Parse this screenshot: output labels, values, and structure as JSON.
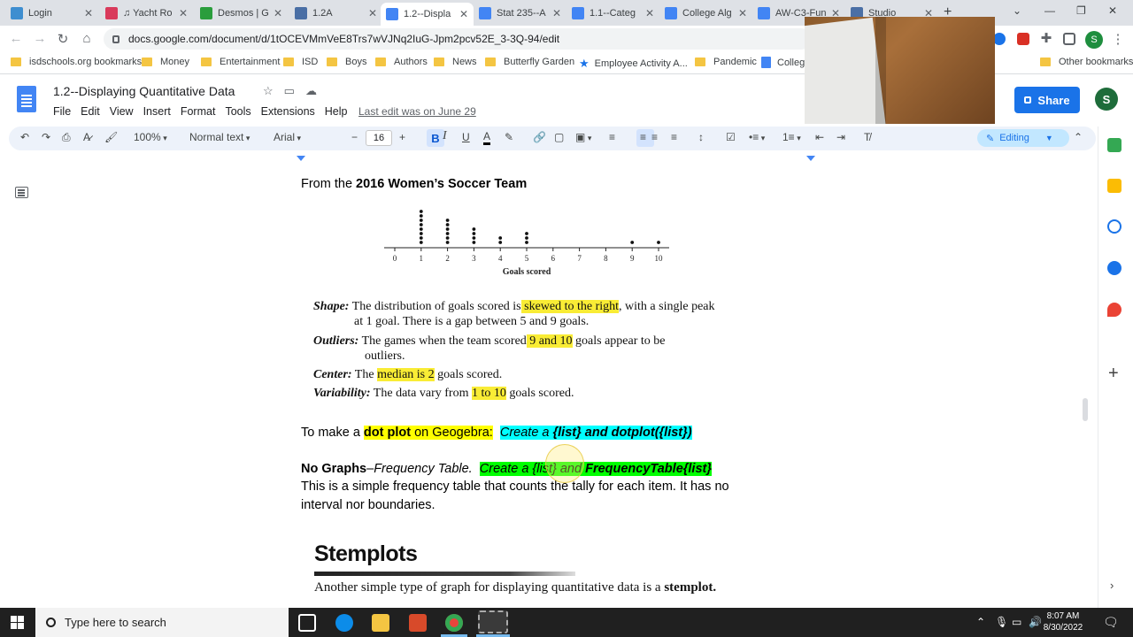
{
  "browser": {
    "tabs": [
      {
        "label": "Login",
        "color": "#3e8ed0"
      },
      {
        "label": "♫ Yacht Ro",
        "color": "#d93a5b"
      },
      {
        "label": "Desmos | G",
        "color": "#2a9d3c"
      },
      {
        "label": "1.2A",
        "color": "#4a6fa5"
      },
      {
        "label": "1.2--Displa",
        "color": "#4285f4"
      },
      {
        "label": "Stat 235--A",
        "color": "#4285f4"
      },
      {
        "label": "1.1--Categ",
        "color": "#4285f4"
      },
      {
        "label": "College Alg",
        "color": "#4285f4"
      },
      {
        "label": "AW-C3-Fun",
        "color": "#4285f4"
      },
      {
        "label": "Studio",
        "color": "#4a6fa5"
      }
    ],
    "url": "docs.google.com/document/d/1tOCEVMmVeE8Trs7wVJNq2IuG-Jpm2pcv52E_3-3Q-94/edit",
    "profile_initial": "S"
  },
  "bookmarks": [
    {
      "label": "isdschools.org bookmarks",
      "type": "folder"
    },
    {
      "label": "Money",
      "type": "folder"
    },
    {
      "label": "Entertainment",
      "type": "folder"
    },
    {
      "label": "ISD",
      "type": "folder"
    },
    {
      "label": "Boys",
      "type": "folder"
    },
    {
      "label": "Authors",
      "type": "folder"
    },
    {
      "label": "News",
      "type": "folder"
    },
    {
      "label": "Butterfly Garden",
      "type": "folder"
    },
    {
      "label": "Employee Activity A...",
      "type": "star"
    },
    {
      "label": "Pandemic",
      "type": "folder"
    },
    {
      "label": "College",
      "type": "doc"
    },
    {
      "label": "Other bookmarks",
      "type": "folder"
    }
  ],
  "docs": {
    "title": "1.2--Displaying Quantitative Data",
    "menu": [
      "File",
      "Edit",
      "View",
      "Insert",
      "Format",
      "Tools",
      "Extensions",
      "Help"
    ],
    "last_edit": "Last edit was on June 29",
    "share_label": "Share",
    "user_initial": "S"
  },
  "toolbar": {
    "zoom": "100%",
    "style": "Normal text",
    "font": "Arial",
    "size": "16",
    "mode": "Editing"
  },
  "content": {
    "intro_pre": "From the ",
    "intro_bold": "2016 Women’s Soccer Team",
    "dotplot": {
      "axis_label": "Goals scored",
      "ticks": [
        "0",
        "1",
        "2",
        "3",
        "4",
        "5",
        "6",
        "7",
        "8",
        "9",
        "10"
      ],
      "counts": [
        0,
        8,
        6,
        4,
        2,
        3,
        0,
        0,
        0,
        1,
        1
      ]
    },
    "shape_label": "Shape:",
    "shape_pre": " The distribution of goals scored is",
    "shape_hl": " skewed to the right",
    "shape_post": ", with a single peak",
    "shape_line2": "at 1 goal. There is a gap between 5 and 9 goals.",
    "outliers_label": "Outliers:",
    "outliers_pre": " The games when the team scored",
    "outliers_hl": " 9 and 10",
    "outliers_post": " goals appear to be",
    "outliers_line2": "outliers.",
    "center_label": "Center:",
    "center_pre": " The ",
    "center_hl": "median is 2",
    "center_post": " goals scored.",
    "variability_label": "Variability:",
    "variability_pre": " The data vary from ",
    "variability_hl": "1 to 10",
    "variability_post": " goals scored.",
    "dotplot_pre": "To make a ",
    "dotplot_bold": "dot plot",
    "dotplot_post": " on Geogebra:",
    "dotplot_cmd_pre": "Create a ",
    "dotplot_cmd_bold": "{list} and dotplot({list})",
    "nographs_bold": "No Graphs",
    "nographs_dash": "–",
    "nographs_italic": "Frequency Table.",
    "nographs_cmd_pre": "Create a {list} and ",
    "nographs_cmd_bold": "FrequencyTable{list}",
    "freq_line1": "This is a simple frequency table that counts the tally for each item.  It has no",
    "freq_line2": "interval nor boundaries.",
    "stemplots_title": "Stemplots",
    "stem_pre": "Another simple type of graph for displaying quantitative data is a ",
    "stem_bold": "stemplot."
  },
  "taskbar": {
    "search_placeholder": "Type here to search",
    "time": "8:07 AM",
    "date": "8/30/2022"
  }
}
